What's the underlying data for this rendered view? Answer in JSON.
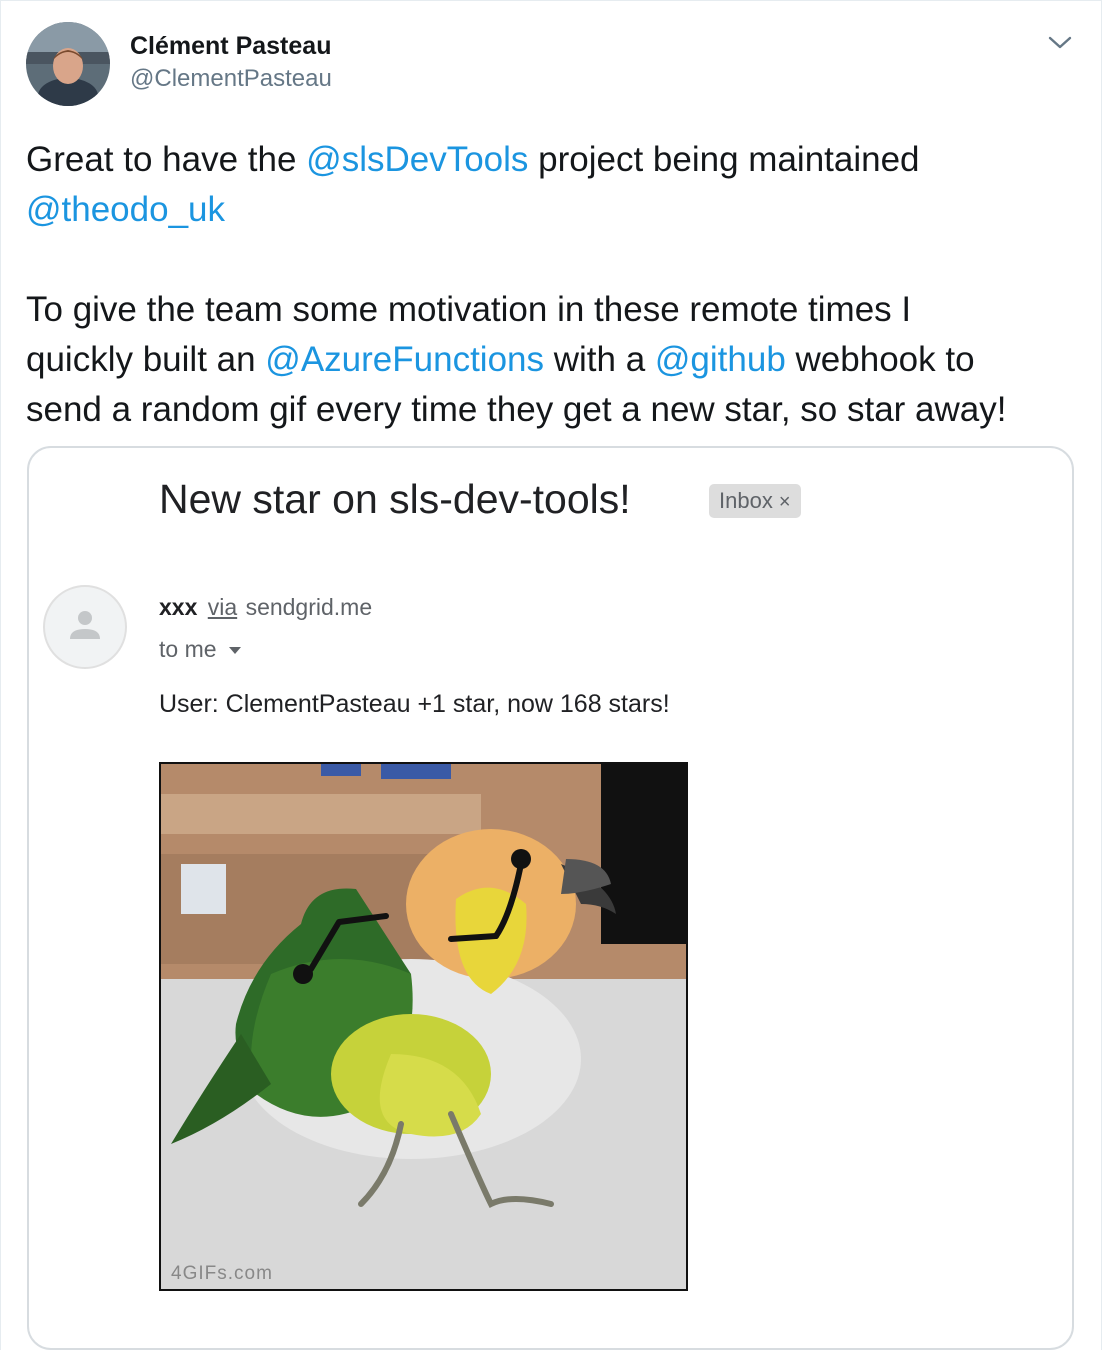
{
  "author": {
    "name": "Clément Pasteau",
    "handle": "@ClementPasteau"
  },
  "tweet": {
    "paragraph1": {
      "t1": "Great to have the ",
      "m1": "@slsDevTools",
      "t2": " project being maintained",
      "m2": "@theodo_uk"
    },
    "paragraph2": {
      "t1": "To give the team some motivation in these remote times I",
      "t2": "quickly built an ",
      "m1": "@AzureFunctions",
      "t3": " with a ",
      "m2": "@github",
      "t4": " webhook to",
      "t5": "send a random gif every time they get a new star, so star away!"
    }
  },
  "email": {
    "subject": "New star on sls-dev-tools!",
    "label_chip": "Inbox",
    "label_close": "×",
    "sender_name": "xxx",
    "via": "via",
    "sender_domain": "sendgrid.me",
    "recipient": "to me",
    "body": "User: ClementPasteau +1 star, now 168 stars!",
    "gif_watermark": "4GIFs.com"
  },
  "colors": {
    "link": "#1b95e0",
    "text": "#14171a",
    "muted": "#657786"
  },
  "icons": {
    "caret": "chevron-down-icon",
    "sender_avatar": "person-icon"
  }
}
